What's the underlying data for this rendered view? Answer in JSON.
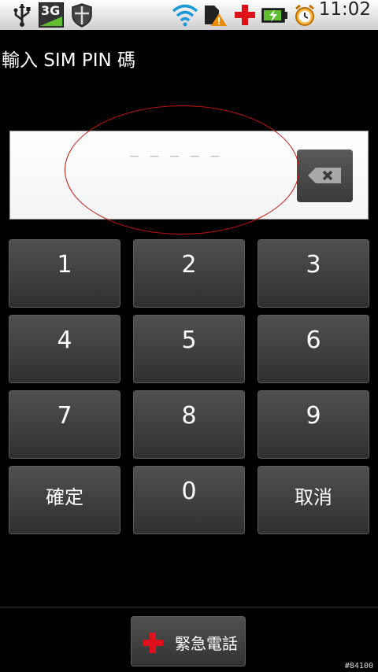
{
  "status_bar": {
    "time": "11:02",
    "network_label": "3G",
    "icons": [
      "usb-icon",
      "3g-signal-icon",
      "shield-icon",
      "wifi-icon",
      "sd-card-warning-icon",
      "red-cross-icon",
      "battery-charging-icon",
      "alarm-clock-icon"
    ],
    "warning_color": "#f08a00",
    "cross_color": "#e0101a"
  },
  "prompt": "輸入 SIM PIN 碼",
  "entry": {
    "value": "",
    "dashes": "_ _ _ _ _"
  },
  "keypad": {
    "keys": [
      "1",
      "2",
      "3",
      "4",
      "5",
      "6",
      "7",
      "8",
      "9",
      "確定",
      "0",
      "取消"
    ]
  },
  "emergency": {
    "label": "緊急電話"
  },
  "watermark": "#84100"
}
